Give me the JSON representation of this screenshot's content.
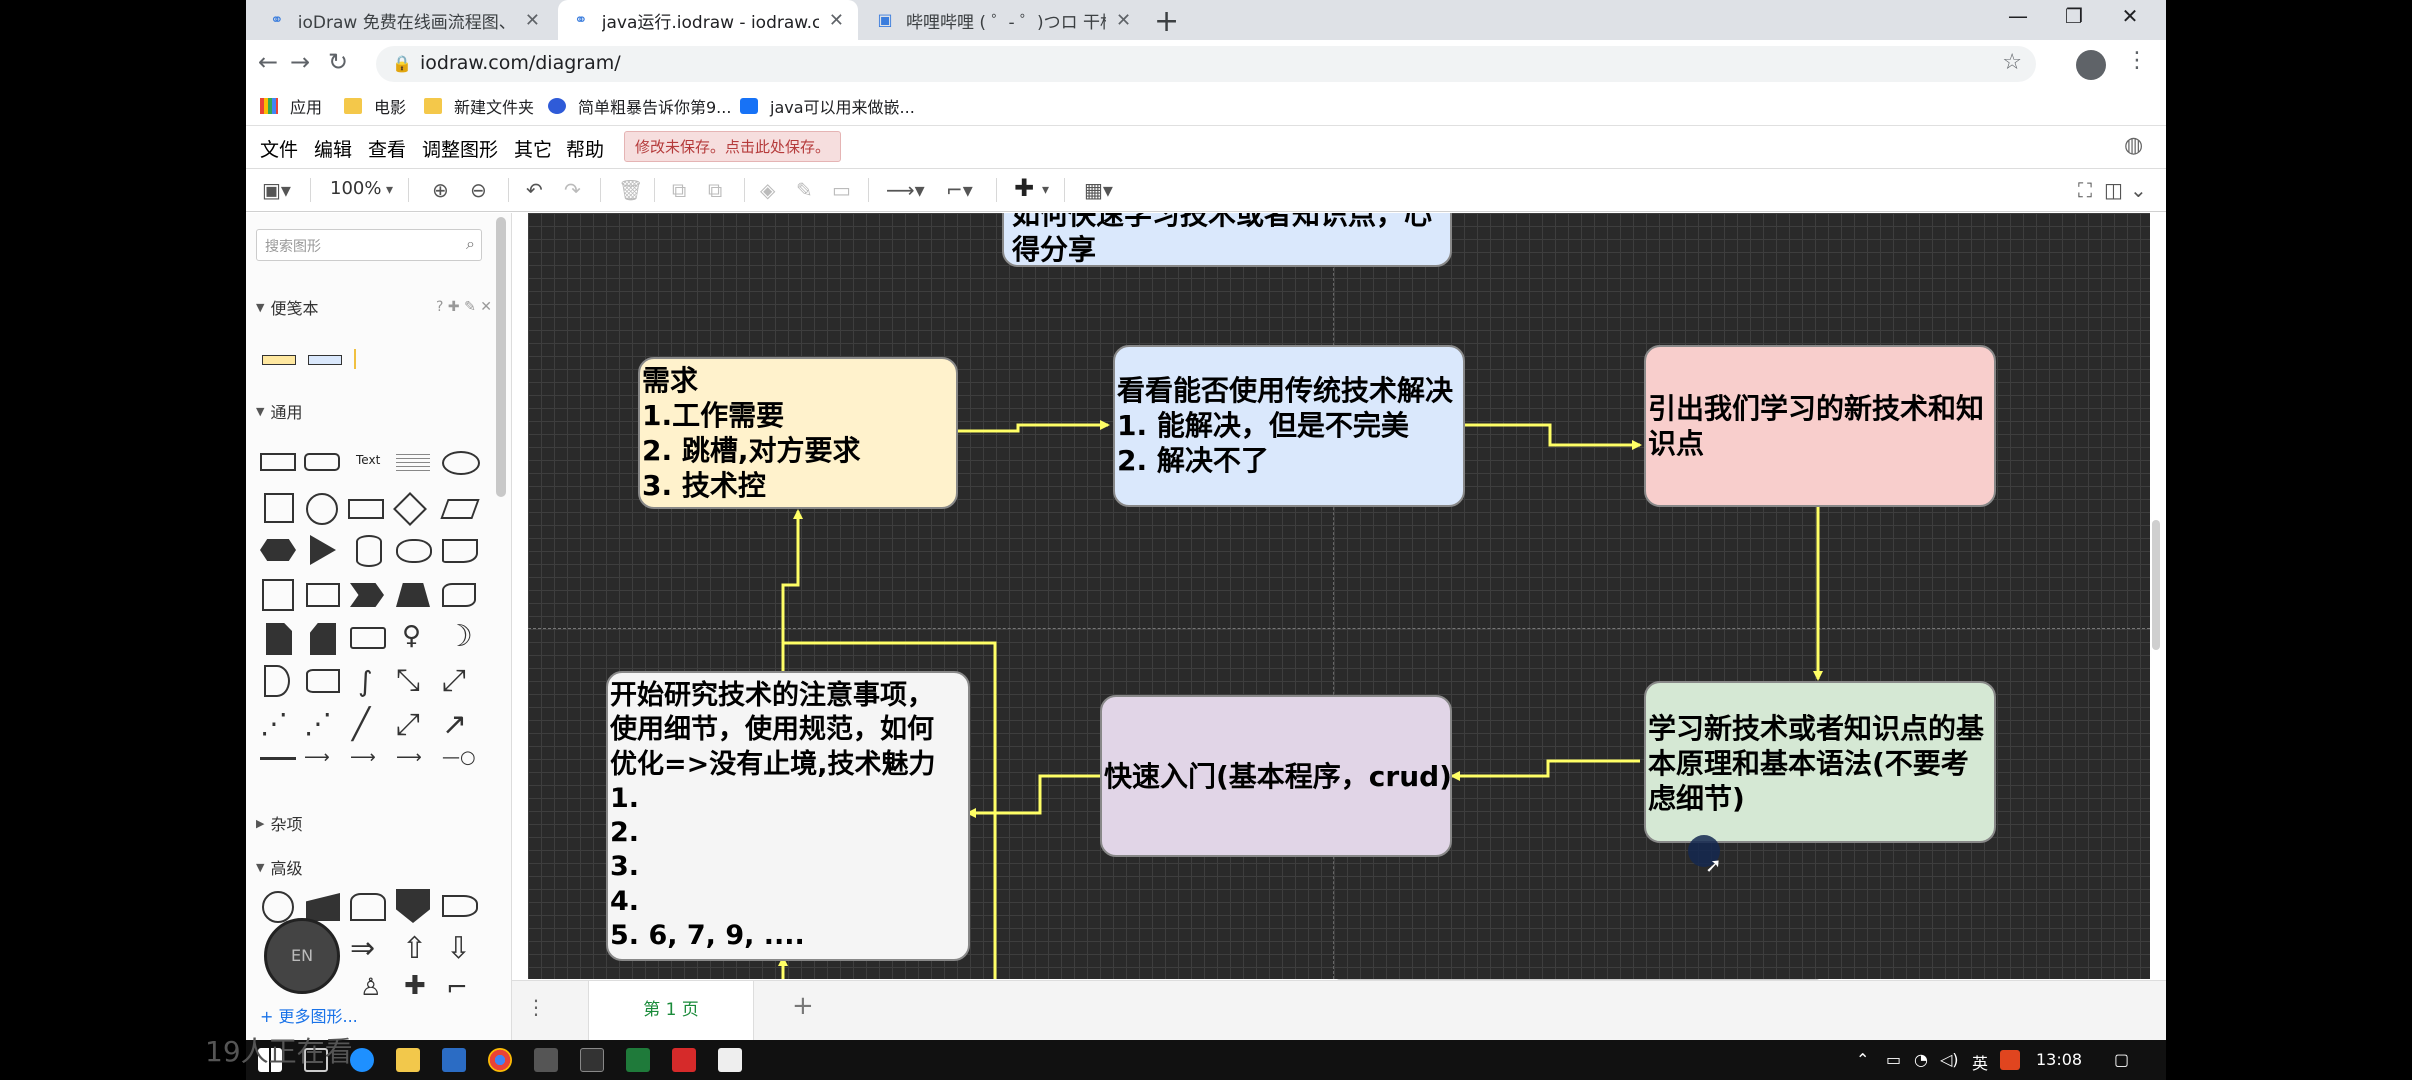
{
  "browser": {
    "tabs": [
      {
        "title": "ioDraw 免费在线画流程图、思维",
        "active": false
      },
      {
        "title": "java运行.iodraw - iodraw.com",
        "active": true
      },
      {
        "title": "哔哩哔哩 ( ゜- ゜)つロ 干杯~-bilibili",
        "active": false
      }
    ],
    "url": "iodraw.com/diagram/",
    "bookmarks": [
      "应用",
      "电影",
      "新建文件夹",
      "简单粗暴告诉你第9...",
      "java可以用来做嵌..."
    ]
  },
  "app": {
    "menu": [
      "文件",
      "编辑",
      "查看",
      "调整图形",
      "其它",
      "帮助"
    ],
    "unsaved_notice": "修改未保存。点击此处保存。",
    "zoom": "100%"
  },
  "sidebar": {
    "search_placeholder": "搜索图形",
    "sections": {
      "notebook": "便笺本",
      "general": "通用",
      "misc": "杂项",
      "advanced": "高级"
    },
    "general_text_shape": "Text",
    "more_shapes": "+ 更多图形..."
  },
  "diagram": {
    "top_node": [
      "如何快速学习技术或者知识点，心",
      "得分享"
    ],
    "need": [
      "需求",
      "1.工作需要",
      "2. 跳槽,对方要求",
      "3. 技术控"
    ],
    "traditional": [
      "看看能否使用传统技术解决",
      "1. 能解决，但是不完美",
      "2. 解决不了"
    ],
    "new_tech": [
      "引出我们学习的新技术和知",
      "识点"
    ],
    "learn_basics": [
      "学习新技术或者知识点的基",
      "本原理和基本语法(不要考",
      "虑细节)"
    ],
    "quick_start": [
      "快速入门(基本程序，crud)"
    ],
    "research": [
      "开始研究技术的注意事项，",
      "使用细节，使用规范，如何",
      "优化=>没有止境,技术魅力",
      "1.",
      "2.",
      "3.",
      "4.",
      "5. 6, 7, 9, ...."
    ]
  },
  "pages": {
    "current": "第 1 页"
  },
  "overlay": {
    "ime": "EN",
    "viewers": "19人正在看"
  },
  "taskbar": {
    "ime_lang": "英",
    "time": "13:08"
  },
  "colors": {
    "need_fill": "#fff2cc",
    "traditional_fill": "#dae8fc",
    "new_tech_fill": "#f8cecc",
    "learn_fill": "#d5e8d4",
    "quick_fill": "#e1d5e7",
    "research_fill": "#f5f5f5",
    "edge": "#ffff66"
  }
}
